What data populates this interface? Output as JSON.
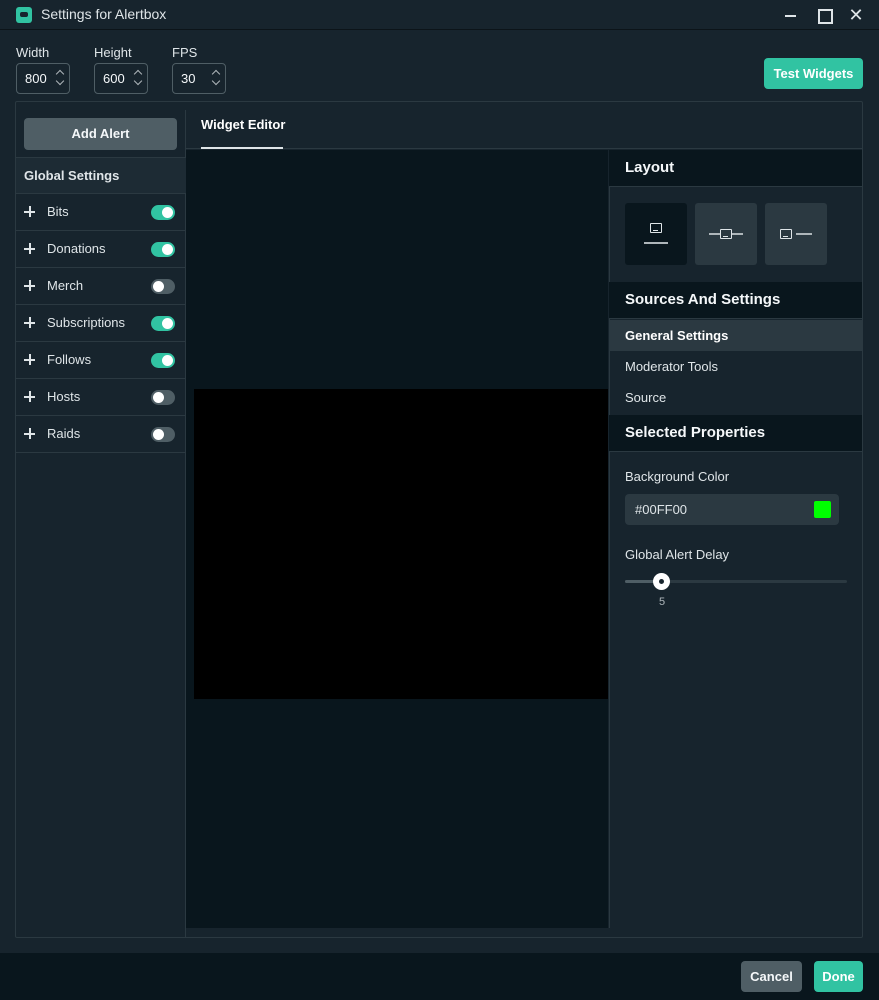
{
  "window": {
    "title": "Settings for Alertbox",
    "close_glyph": "✕"
  },
  "dimensions": {
    "width_label": "Width",
    "width_value": "800",
    "height_label": "Height",
    "height_value": "600",
    "fps_label": "FPS",
    "fps_value": "30"
  },
  "toolbar": {
    "test_widgets_label": "Test Widgets"
  },
  "sidebar": {
    "add_alert_label": "Add Alert",
    "global_settings_label": "Global Settings",
    "alerts": [
      {
        "label": "Bits",
        "enabled": true
      },
      {
        "label": "Donations",
        "enabled": true
      },
      {
        "label": "Merch",
        "enabled": false
      },
      {
        "label": "Subscriptions",
        "enabled": true
      },
      {
        "label": "Follows",
        "enabled": true
      },
      {
        "label": "Hosts",
        "enabled": false
      },
      {
        "label": "Raids",
        "enabled": false
      }
    ]
  },
  "editor": {
    "tab_label": "Widget Editor"
  },
  "right_panel": {
    "layout_title": "Layout",
    "sources_title": "Sources And Settings",
    "sources": [
      {
        "label": "General Settings",
        "active": true
      },
      {
        "label": "Moderator Tools",
        "active": false
      },
      {
        "label": "Source",
        "active": false
      }
    ],
    "properties_title": "Selected Properties",
    "background_color_label": "Background Color",
    "background_color_value": "#00FF00",
    "alert_delay_label": "Global Alert Delay",
    "alert_delay_value": "5",
    "alert_delay_fraction": 0.16
  },
  "footer": {
    "cancel_label": "Cancel",
    "done_label": "Done"
  },
  "colors": {
    "accent": "#31c3a2",
    "background": "#17242d",
    "swatch": "#00FF00",
    "toggle_off": "#4f5e65"
  }
}
